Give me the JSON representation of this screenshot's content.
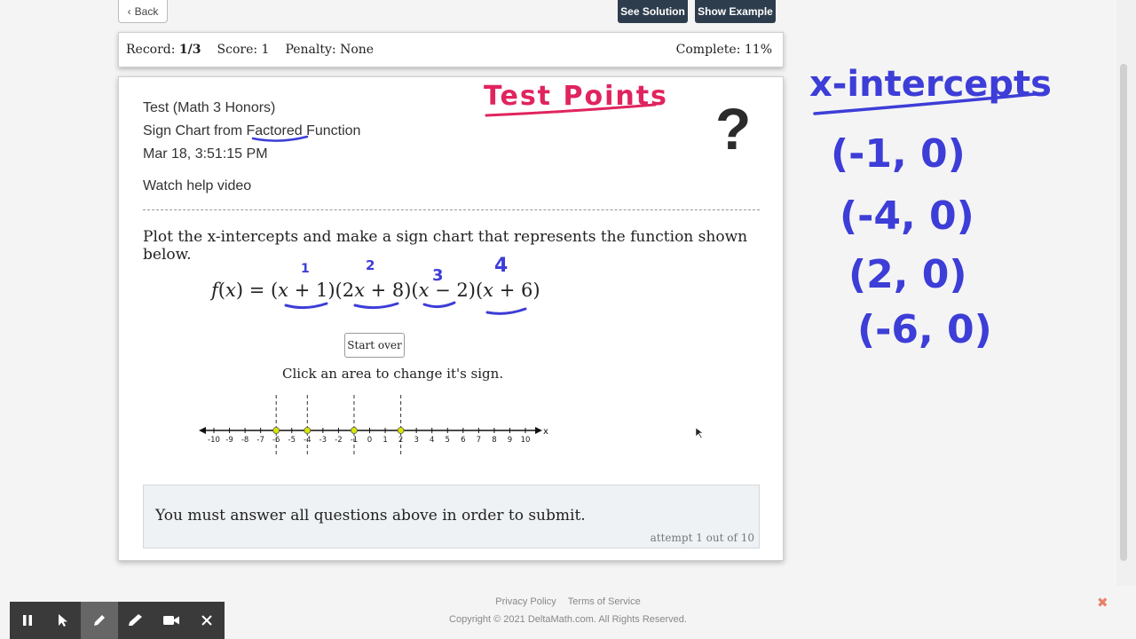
{
  "top_buttons": {
    "back": "Back",
    "see_solution": "See Solution",
    "show_example": "Show Example"
  },
  "record_bar": {
    "record_label": "Record: ",
    "record_value": "1/3",
    "score": "Score: 1",
    "penalty": "Penalty: None",
    "complete": "Complete: 11%"
  },
  "meta": {
    "course": "Test (Math 3 Honors)",
    "topic_prefix": "Sign Chart from ",
    "topic_underlined": "Factored",
    "topic_suffix": " Function",
    "timestamp": "Mar 18, 3:51:15 PM",
    "help_link": "Watch help video"
  },
  "help_icon": "?",
  "question": {
    "prompt": "Plot the x-intercepts and make a sign chart that represents the function shown below.",
    "formula": {
      "lhs_f": "f",
      "lhs_x": "x",
      "eq": ") = (",
      "t1_var": "x",
      "t1_rest": " + 1)(2",
      "t2_var": "x",
      "t2_rest": " + 8)(",
      "t3_var": "x",
      "t3_rest": " − 2)(",
      "t4_var": "x",
      "t4_rest": " + 6)"
    },
    "start_over": "Start over",
    "instruction": "Click an area to change it's sign."
  },
  "number_line": {
    "min": -10,
    "max": 10,
    "ticks": [
      "-10",
      "-9",
      "-8",
      "-7",
      "-6",
      "-5",
      "-4",
      "-3",
      "-2",
      "-1",
      "0",
      "1",
      "2",
      "3",
      "4",
      "5",
      "6",
      "7",
      "8",
      "9",
      "10"
    ],
    "axis_label": "x",
    "points": [
      -6,
      -4,
      -1,
      2
    ],
    "point_color": "#d8e600"
  },
  "submit": {
    "message": "You must answer all questions above in order to submit.",
    "attempt": "attempt 1 out of 10"
  },
  "annotations": {
    "test_points": "Test Points",
    "term_numbers": [
      "1",
      "2",
      "3",
      "4"
    ],
    "x_intercepts_title": "x-intercepts",
    "intercepts": [
      "(-1, 0)",
      "(-4, 0)",
      "(2, 0)",
      "(-6, 0)"
    ],
    "red": "#e0245e",
    "blue": "#3d3dd8"
  },
  "footer": {
    "privacy": "Privacy Policy",
    "terms": "Terms of Service",
    "copyright": "Copyright © 2021 DeltaMath.com. All Rights Reserved."
  },
  "toolbar": {
    "icons": [
      "pause-icon",
      "pointer-icon",
      "pen-icon",
      "highlighter-icon",
      "camera-icon",
      "close-icon"
    ]
  }
}
